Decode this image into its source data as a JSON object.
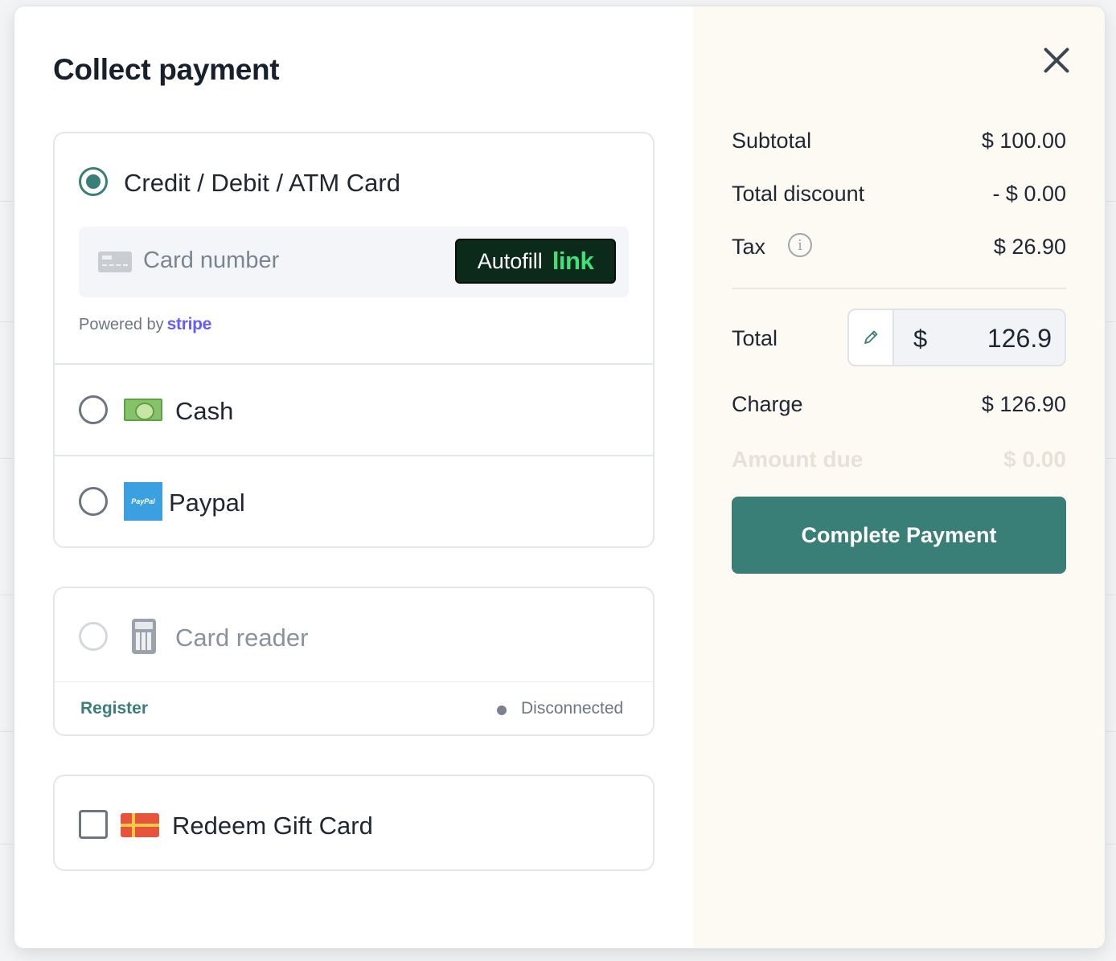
{
  "modal": {
    "title": "Collect payment"
  },
  "payment_methods": {
    "card": {
      "label": "Credit / Debit / ATM Card",
      "selected": true,
      "card_number_placeholder": "Card number",
      "autofill_text": "Autofill",
      "autofill_brand": "link",
      "powered_by": "Powered by",
      "provider": "stripe"
    },
    "cash": {
      "label": "Cash",
      "selected": false
    },
    "paypal": {
      "label": "Paypal",
      "selected": false,
      "icon_text": "PayPal"
    },
    "card_reader": {
      "label": "Card reader",
      "enabled": false,
      "register_label": "Register",
      "status": "Disconnected"
    },
    "gift_card": {
      "label": "Redeem Gift Card",
      "checked": false
    }
  },
  "summary": {
    "subtotal_label": "Subtotal",
    "subtotal_value": "$ 100.00",
    "discount_label": "Total discount",
    "discount_value": "- $ 0.00",
    "tax_label": "Tax",
    "tax_value": "$ 26.90",
    "total_label": "Total",
    "total_currency": "$",
    "total_value": "126.9",
    "charge_label": "Charge",
    "charge_value": "$ 126.90",
    "amount_due_label": "Amount due",
    "amount_due_value": "$ 0.00",
    "complete_button": "Complete Payment"
  },
  "colors": {
    "accent": "#3a7f77",
    "summary_bg": "#fdfaf3",
    "link_green": "#3ee27c",
    "stripe_purple": "#635bff"
  },
  "icons": [
    "card-icon",
    "cash-icon",
    "paypal-icon",
    "card-reader-icon",
    "gift-card-icon",
    "info-icon",
    "pencil-icon",
    "close-icon"
  ]
}
